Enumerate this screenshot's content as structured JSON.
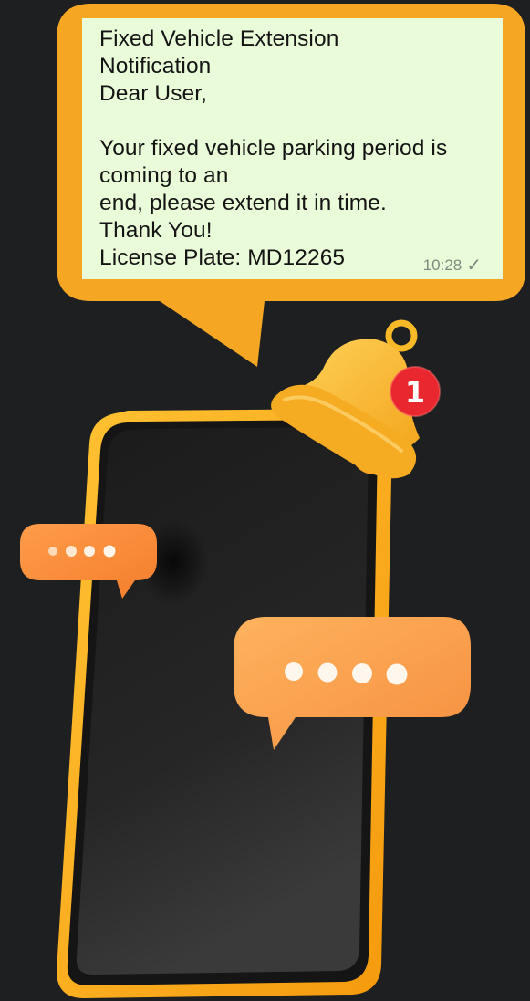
{
  "message": {
    "title_line1": "Fixed Vehicle Extension",
    "title_line2": "Notification",
    "body": "Dear User,\n\nYour fixed vehicle parking period is\ncoming to an\nend, please extend it in time.\nThank You!\nLicense Plate: MD12265",
    "time": "10:28",
    "status_icon": "check-icon"
  },
  "notification_badge": {
    "count": "1"
  },
  "colors": {
    "background": "#1d1f21",
    "bubble_orange": "#f5a623",
    "message_background": "#eafbd9",
    "badge_red": "#e8272f"
  }
}
